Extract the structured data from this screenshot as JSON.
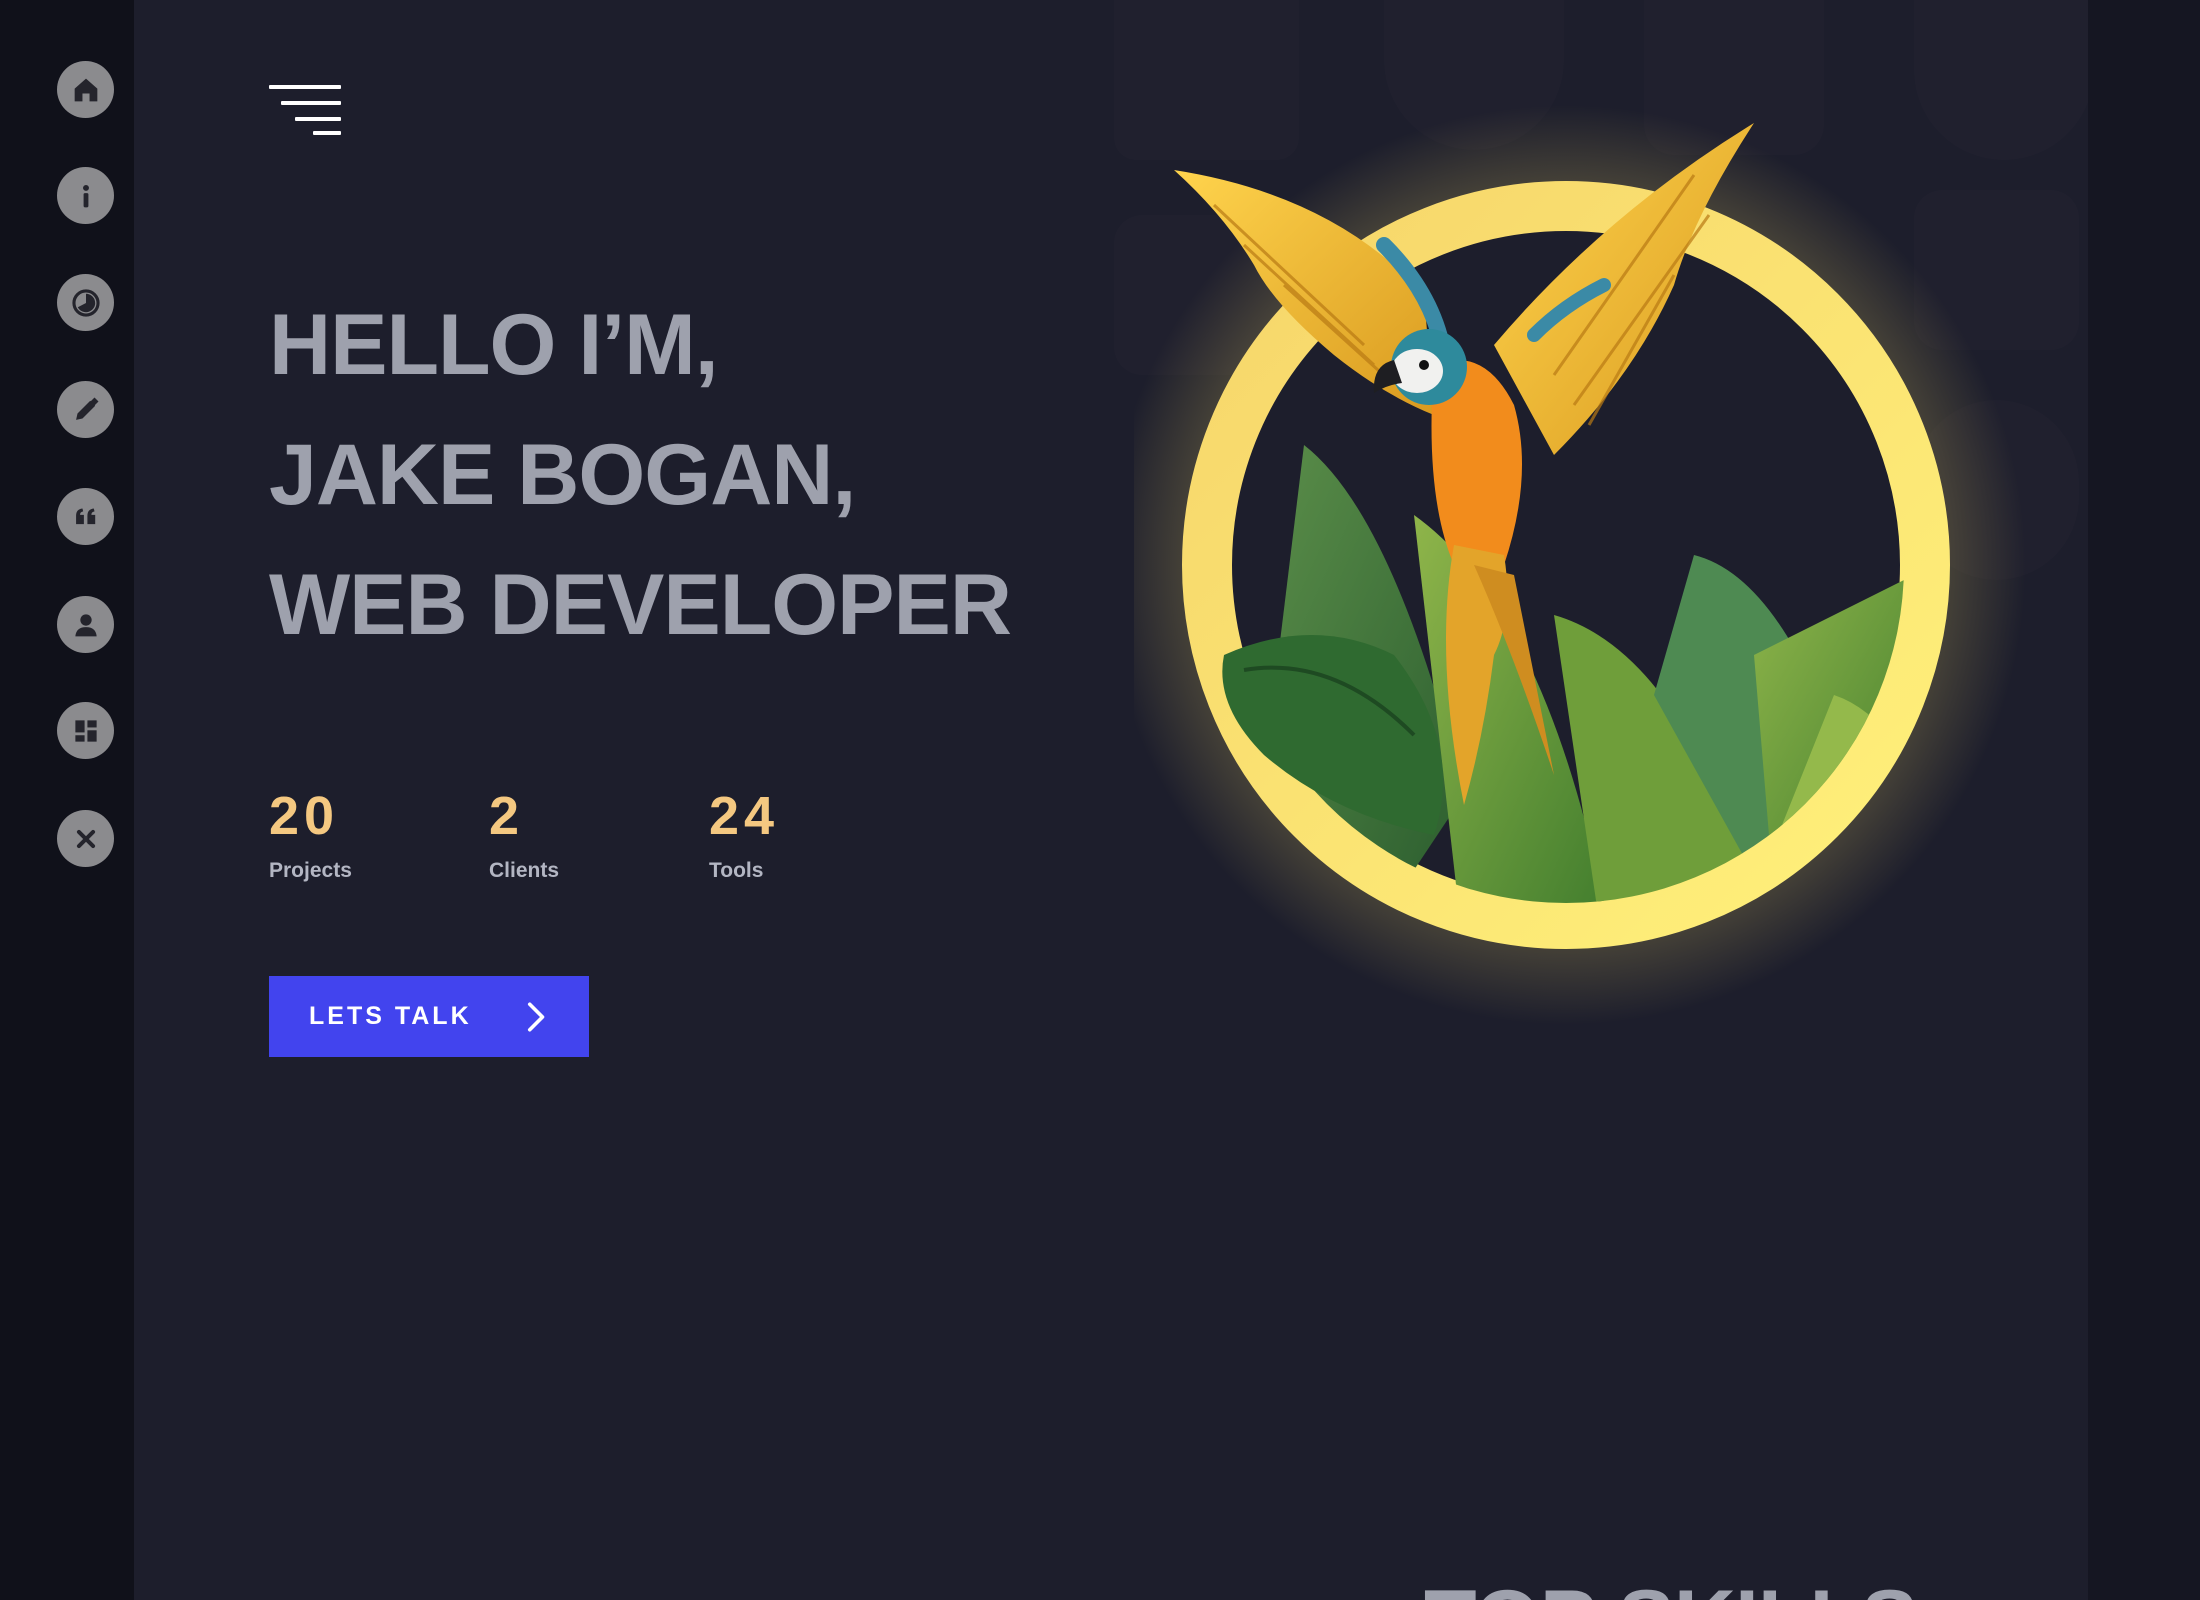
{
  "sidebar": {
    "items": [
      {
        "icon": "home-icon",
        "label": "Home"
      },
      {
        "icon": "info-icon",
        "label": "About"
      },
      {
        "icon": "pie-chart-icon",
        "label": "Skills"
      },
      {
        "icon": "pencil-icon",
        "label": "Work"
      },
      {
        "icon": "quote-icon",
        "label": "Testimonials"
      },
      {
        "icon": "user-icon",
        "label": "Profile"
      },
      {
        "icon": "dashboard-icon",
        "label": "Portfolio"
      },
      {
        "icon": "close-icon",
        "label": "Close"
      }
    ]
  },
  "header": {
    "menu_icon": "hamburger-menu-icon"
  },
  "hero": {
    "line1": "HELLO I’M,",
    "line2": "JAKE BOGAN,",
    "line3": "WEB DEVELOPER",
    "stats": [
      {
        "value": "20",
        "label": "Projects"
      },
      {
        "value": "2",
        "label": "Clients"
      },
      {
        "value": "24",
        "label": "Tools"
      }
    ],
    "cta_label": "LETS TALK",
    "cta_icon": "chevron-right-icon"
  },
  "next_section": {
    "title": "TOP SKILLS"
  },
  "colors": {
    "background": "#1d1e2c",
    "rail": "#10111a",
    "headline": "#9ea1ad",
    "stat_value": "#f4c881",
    "accent_button": "#4244ee",
    "ring": "#fbe46b"
  }
}
